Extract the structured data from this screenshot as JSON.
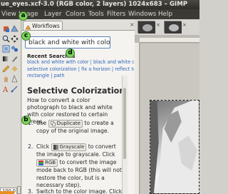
{
  "window": {
    "title": "ue_eyes.xcf-3.0 (RGB color, 2 layers) 1024x683 – GIMP"
  },
  "menubar": {
    "items": [
      "View",
      "Image",
      "Layer",
      "Colors",
      "Tools",
      "Filters",
      "Windows",
      "Help"
    ]
  },
  "toolbox": {
    "size_value": "100.0"
  },
  "dock": {
    "tab_label": "Workflows",
    "tab_close": "×"
  },
  "search": {
    "value": "black and white with color"
  },
  "recent": {
    "heading": "Recent Searches",
    "rows": [
      [
        "black and white with color",
        "black and white color"
      ],
      [
        "selective colorization",
        "fix a horizon",
        "reflect text",
        "draw"
      ],
      [
        "rectangle",
        "path"
      ]
    ]
  },
  "article": {
    "title": "Selective Colorization",
    "intro": "How to convert a color photograph to black and white with color restored to certain areas.",
    "steps": [
      {
        "num": "1.",
        "pre": "Use",
        "chip": "Duplicate",
        "post": "to create a copy of the original image."
      },
      {
        "num": "2.",
        "pre": "Click",
        "chip": "Grayscale",
        "mid": "to convert the image to grayscale. Click",
        "chip2": "RGB",
        "post": "to convert the image mode back to RGB (this will not restore the color, but is a necessary step)."
      },
      {
        "num": "3.",
        "pre": "Switch to the color image. Click"
      }
    ]
  },
  "callouts": {
    "a": "a",
    "b": "b",
    "c": "c",
    "d": "d"
  },
  "image_window": {
    "thumb_close": "×"
  },
  "colors": {
    "link": "#3166b8",
    "callout": "#7bd35b",
    "search_border": "#5d7fb5"
  }
}
